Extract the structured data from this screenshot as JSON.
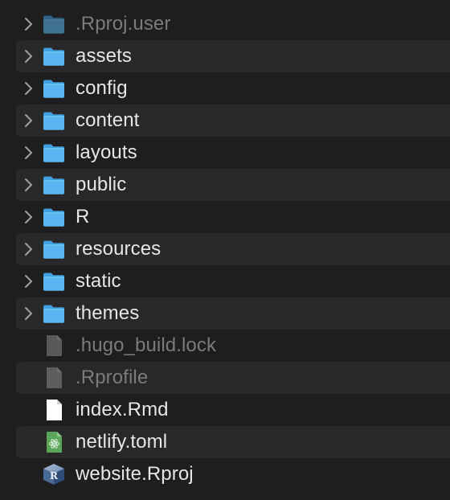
{
  "window": {
    "title": ""
  },
  "file_list": {
    "items": [
      {
        "name": ".Rproj.user",
        "kind": "folder",
        "expandable": true,
        "dimmed": true
      },
      {
        "name": "assets",
        "kind": "folder",
        "expandable": true,
        "dimmed": false
      },
      {
        "name": "config",
        "kind": "folder",
        "expandable": true,
        "dimmed": false
      },
      {
        "name": "content",
        "kind": "folder",
        "expandable": true,
        "dimmed": false
      },
      {
        "name": "layouts",
        "kind": "folder",
        "expandable": true,
        "dimmed": false
      },
      {
        "name": "public",
        "kind": "folder",
        "expandable": true,
        "dimmed": false
      },
      {
        "name": "R",
        "kind": "folder",
        "expandable": true,
        "dimmed": false
      },
      {
        "name": "resources",
        "kind": "folder",
        "expandable": true,
        "dimmed": false
      },
      {
        "name": "static",
        "kind": "folder",
        "expandable": true,
        "dimmed": false
      },
      {
        "name": "themes",
        "kind": "folder",
        "expandable": true,
        "dimmed": false
      },
      {
        "name": ".hugo_build.lock",
        "kind": "hidden-file",
        "expandable": false,
        "dimmed": true
      },
      {
        "name": ".Rprofile",
        "kind": "hidden-file",
        "expandable": false,
        "dimmed": true
      },
      {
        "name": "index.Rmd",
        "kind": "document",
        "expandable": false,
        "dimmed": false
      },
      {
        "name": "netlify.toml",
        "kind": "toml-file",
        "expandable": false,
        "dimmed": false
      },
      {
        "name": "website.Rproj",
        "kind": "rproj-file",
        "expandable": false,
        "dimmed": false
      }
    ]
  },
  "icons": {
    "folder": "folder-icon",
    "hidden-file": "generic-file-icon",
    "document": "document-icon",
    "toml-file": "toml-file-icon",
    "rproj-file": "rproj-file-icon",
    "chevron": "chevron-right-icon"
  },
  "colors": {
    "background": "#1e1e1e",
    "stripe": "#282828",
    "text": "#e6e6e6",
    "dim_text": "#7b7b7b",
    "folder_blue": "#5ab5f0",
    "toml_green": "#5aa55a"
  }
}
